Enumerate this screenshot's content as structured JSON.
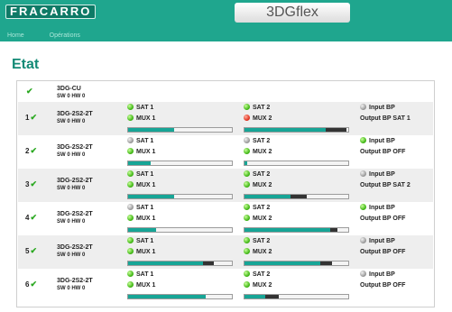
{
  "header": {
    "logo": "FRACARRO",
    "product": "3DGflex"
  },
  "nav": {
    "items": [
      "Home",
      "Opérations"
    ]
  },
  "page_title": "Etat",
  "colors": {
    "accent": "#1fa68e",
    "title": "#138a76",
    "led_ok": "#3fb614",
    "led_error": "#e0301e",
    "led_off": "#9a9a9a",
    "bar_fill": "#17a596"
  },
  "root": {
    "device": "3DG-CU",
    "version": "SW 0 HW 0",
    "status": "ok"
  },
  "rows": [
    {
      "num": "1",
      "device": "3DG-2S2-2T",
      "version": "SW 0 HW 0",
      "sat1": {
        "label": "SAT 1",
        "led": "green"
      },
      "mux1": {
        "label": "MUX 1",
        "led": "green"
      },
      "bar1": {
        "level": 0.44,
        "excess": 0
      },
      "sat2": {
        "label": "SAT 2",
        "led": "green"
      },
      "mux2": {
        "label": "MUX 2",
        "led": "red"
      },
      "bar2": {
        "level": 0.78,
        "excess": 0.2
      },
      "bp1": {
        "label": "Input BP",
        "led": "grey"
      },
      "bp2": "Output BP SAT 1"
    },
    {
      "num": "2",
      "device": "3DG-2S2-2T",
      "version": "SW 0 HW 0",
      "sat1": {
        "label": "SAT 1",
        "led": "grey"
      },
      "mux1": {
        "label": "MUX 1",
        "led": "green"
      },
      "bar1": {
        "level": 0.22,
        "excess": 0
      },
      "sat2": {
        "label": "SAT 2",
        "led": "grey"
      },
      "mux2": {
        "label": "MUX 2",
        "led": "green"
      },
      "bar2": {
        "level": 0.03,
        "excess": 0
      },
      "bp1": {
        "label": "Input BP",
        "led": "green"
      },
      "bp2": "Output BP OFF"
    },
    {
      "num": "3",
      "device": "3DG-2S2-2T",
      "version": "SW 0 HW 0",
      "sat1": {
        "label": "SAT 1",
        "led": "green"
      },
      "mux1": {
        "label": "MUX 1",
        "led": "green"
      },
      "bar1": {
        "level": 0.44,
        "excess": 0
      },
      "sat2": {
        "label": "SAT 2",
        "led": "green"
      },
      "mux2": {
        "label": "MUX 2",
        "led": "green"
      },
      "bar2": {
        "level": 0.44,
        "excess": 0.16
      },
      "bp1": {
        "label": "Input BP",
        "led": "grey"
      },
      "bp2": "Output BP SAT 2"
    },
    {
      "num": "4",
      "device": "3DG-2S2-2T",
      "version": "SW 0 HW 0",
      "sat1": {
        "label": "SAT 1",
        "led": "grey"
      },
      "mux1": {
        "label": "MUX 1",
        "led": "green"
      },
      "bar1": {
        "level": 0.27,
        "excess": 0
      },
      "sat2": {
        "label": "SAT 2",
        "led": "green"
      },
      "mux2": {
        "label": "MUX 2",
        "led": "green"
      },
      "bar2": {
        "level": 0.83,
        "excess": 0.07
      },
      "bp1": {
        "label": "Input BP",
        "led": "green"
      },
      "bp2": "Output BP OFF"
    },
    {
      "num": "5",
      "device": "3DG-2S2-2T",
      "version": "SW 0 HW 0",
      "sat1": {
        "label": "SAT 1",
        "led": "green"
      },
      "mux1": {
        "label": "MUX 1",
        "led": "green"
      },
      "bar1": {
        "level": 0.72,
        "excess": 0.11
      },
      "sat2": {
        "label": "SAT 2",
        "led": "green"
      },
      "mux2": {
        "label": "MUX 2",
        "led": "green"
      },
      "bar2": {
        "level": 0.73,
        "excess": 0.11
      },
      "bp1": {
        "label": "Input BP",
        "led": "grey"
      },
      "bp2": "Output BP OFF"
    },
    {
      "num": "6",
      "device": "3DG-2S2-2T",
      "version": "SW 0 HW 0",
      "sat1": {
        "label": "SAT 1",
        "led": "green"
      },
      "mux1": {
        "label": "MUX 1",
        "led": "green"
      },
      "bar1": {
        "level": 0.75,
        "excess": 0
      },
      "sat2": {
        "label": "SAT 2",
        "led": "green"
      },
      "mux2": {
        "label": "MUX 2",
        "led": "green"
      },
      "bar2": {
        "level": 0.2,
        "excess": 0.13
      },
      "bp1": {
        "label": "Input BP",
        "led": "grey"
      },
      "bp2": "Output BP OFF"
    }
  ]
}
